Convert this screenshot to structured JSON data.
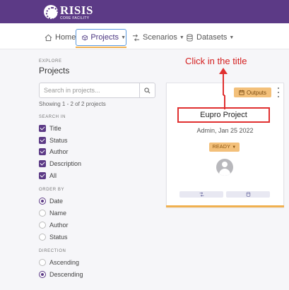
{
  "brand": {
    "name": "RISIS",
    "subtitle": "CORE FACILITY"
  },
  "nav": {
    "home": "Home",
    "projects": "Projects",
    "scenarios": "Scenarios",
    "datasets": "Datasets"
  },
  "sidebar": {
    "explore_label": "EXPLORE",
    "title": "Projects",
    "search_placeholder": "Search in projects...",
    "showing": "Showing 1 - 2 of 2 projects",
    "search_in": {
      "label": "SEARCH IN",
      "options": [
        "Title",
        "Status",
        "Author",
        "Description",
        "All"
      ],
      "checked": [
        true,
        true,
        true,
        true,
        true
      ]
    },
    "order_by": {
      "label": "ORDER BY",
      "options": [
        "Date",
        "Name",
        "Author",
        "Status"
      ],
      "selected": "Date"
    },
    "direction": {
      "label": "DIRECTION",
      "options": [
        "Ascending",
        "Descending"
      ],
      "selected": "Descending"
    }
  },
  "card": {
    "outputs_label": "Outputs",
    "title": "Eupro Project",
    "meta": "Admin, Jan 25 2022",
    "status": "READY"
  },
  "annotation": {
    "text": "Click in the title",
    "color": "#d42020"
  },
  "colors": {
    "brand": "#5c3a86",
    "accent": "#f0b050",
    "highlight": "#e03030"
  }
}
